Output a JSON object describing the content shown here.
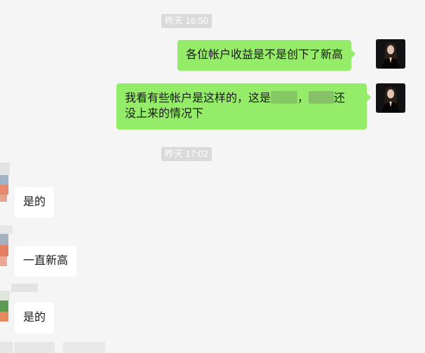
{
  "timestamps": [
    "昨天 16:50",
    "昨天 17:02"
  ],
  "messages": {
    "m1": "各位帐户收益是不是创下了新高",
    "m2_line1_a": "我看有些帐户是这样的，这是",
    "m2_line1_sep": "，",
    "m2_line1_b": "还",
    "m2_line2": "没上来的情况下",
    "r1": "是的",
    "r2": "一直新高",
    "r3": "是的"
  },
  "colors": {
    "outgoing_bubble": "#95ec69",
    "incoming_bubble": "#ffffff",
    "background": "#f5f5f5"
  },
  "icons": {
    "self_avatar": "woman-portrait-avatar",
    "contact_avatar": "pixelated-avatar"
  }
}
